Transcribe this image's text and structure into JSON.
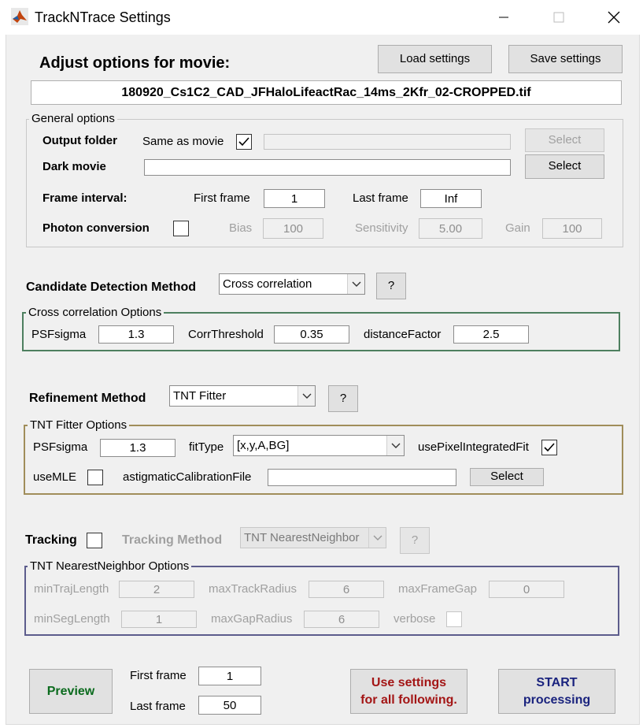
{
  "window": {
    "title": "TrackNTrace Settings",
    "controls": [
      "minimize-icon",
      "maximize-icon",
      "close-icon"
    ]
  },
  "header": {
    "adjust_label": "Adjust options for movie:",
    "load_button": "Load settings",
    "save_button": "Save settings",
    "movie_filename": "180920_Cs1C2_CAD_JFHaloLifeactRac_14ms_2Kfr_02-CROPPED.tif"
  },
  "general": {
    "title": "General options",
    "output_folder_label": "Output folder",
    "same_as_movie_label": "Same as movie",
    "same_as_movie_checked": true,
    "output_folder_value": "",
    "output_select_button": "Select",
    "dark_movie_label": "Dark movie",
    "dark_movie_value": "",
    "dark_select_button": "Select",
    "frame_interval_label": "Frame interval:",
    "first_frame_label": "First frame",
    "first_frame_value": "1",
    "last_frame_label": "Last frame",
    "last_frame_value": "Inf",
    "photon_conversion_label": "Photon conversion",
    "photon_conversion_checked": false,
    "bias_label": "Bias",
    "bias_value": "100",
    "sensitivity_label": "Sensitivity",
    "sensitivity_value": "5.00",
    "gain_label": "Gain",
    "gain_value": "100"
  },
  "candidate": {
    "label": "Candidate Detection Method",
    "method": "Cross correlation",
    "help_button": "?",
    "options_title": "Cross correlation Options",
    "psfsigma_label": "PSFsigma",
    "psfsigma_value": "1.3",
    "corrthreshold_label": "CorrThreshold",
    "corrthreshold_value": "0.35",
    "distancefactor_label": "distanceFactor",
    "distancefactor_value": "2.5"
  },
  "refinement": {
    "label": "Refinement Method",
    "method": "TNT Fitter",
    "help_button": "?",
    "options_title": "TNT Fitter Options",
    "psfsigma_label": "PSFsigma",
    "psfsigma_value": "1.3",
    "fittype_label": "fitType",
    "fittype_value": "[x,y,A,BG]",
    "usepixelintegratedfit_label": "usePixelIntegratedFit",
    "usepixelintegratedfit_checked": true,
    "usemle_label": "useMLE",
    "usemle_checked": false,
    "astig_label": "astigmaticCalibrationFile",
    "astig_value": "",
    "astig_select_button": "Select"
  },
  "tracking": {
    "label": "Tracking",
    "checked": false,
    "method_label": "Tracking Method",
    "method": "TNT NearestNeighbor",
    "help_button": "?",
    "options_title": "TNT NearestNeighbor Options",
    "mintrajlength_label": "minTrajLength",
    "mintrajlength_value": "2",
    "maxtrackradius_label": "maxTrackRadius",
    "maxtrackradius_value": "6",
    "maxframegap_label": "maxFrameGap",
    "maxframegap_value": "0",
    "minseglength_label": "minSegLength",
    "minseglength_value": "1",
    "maxgapradius_label": "maxGapRadius",
    "maxgapradius_value": "6",
    "verbose_label": "verbose",
    "verbose_checked": false
  },
  "footer": {
    "preview_button": "Preview",
    "first_frame_label": "First frame",
    "first_frame_value": "1",
    "last_frame_label": "Last frame",
    "last_frame_value": "50",
    "use_settings_line1": "Use settings",
    "use_settings_line2": "for all following.",
    "start_line1": "START",
    "start_line2": "processing"
  },
  "colors": {
    "candidate_panel_border": "#4d7f5f",
    "refinement_panel_border": "#a08d5a",
    "tracking_panel_border": "#5c5c8c",
    "preview_text": "#0b6b1e",
    "use_settings_text": "#a31515",
    "start_text": "#1a237e"
  }
}
